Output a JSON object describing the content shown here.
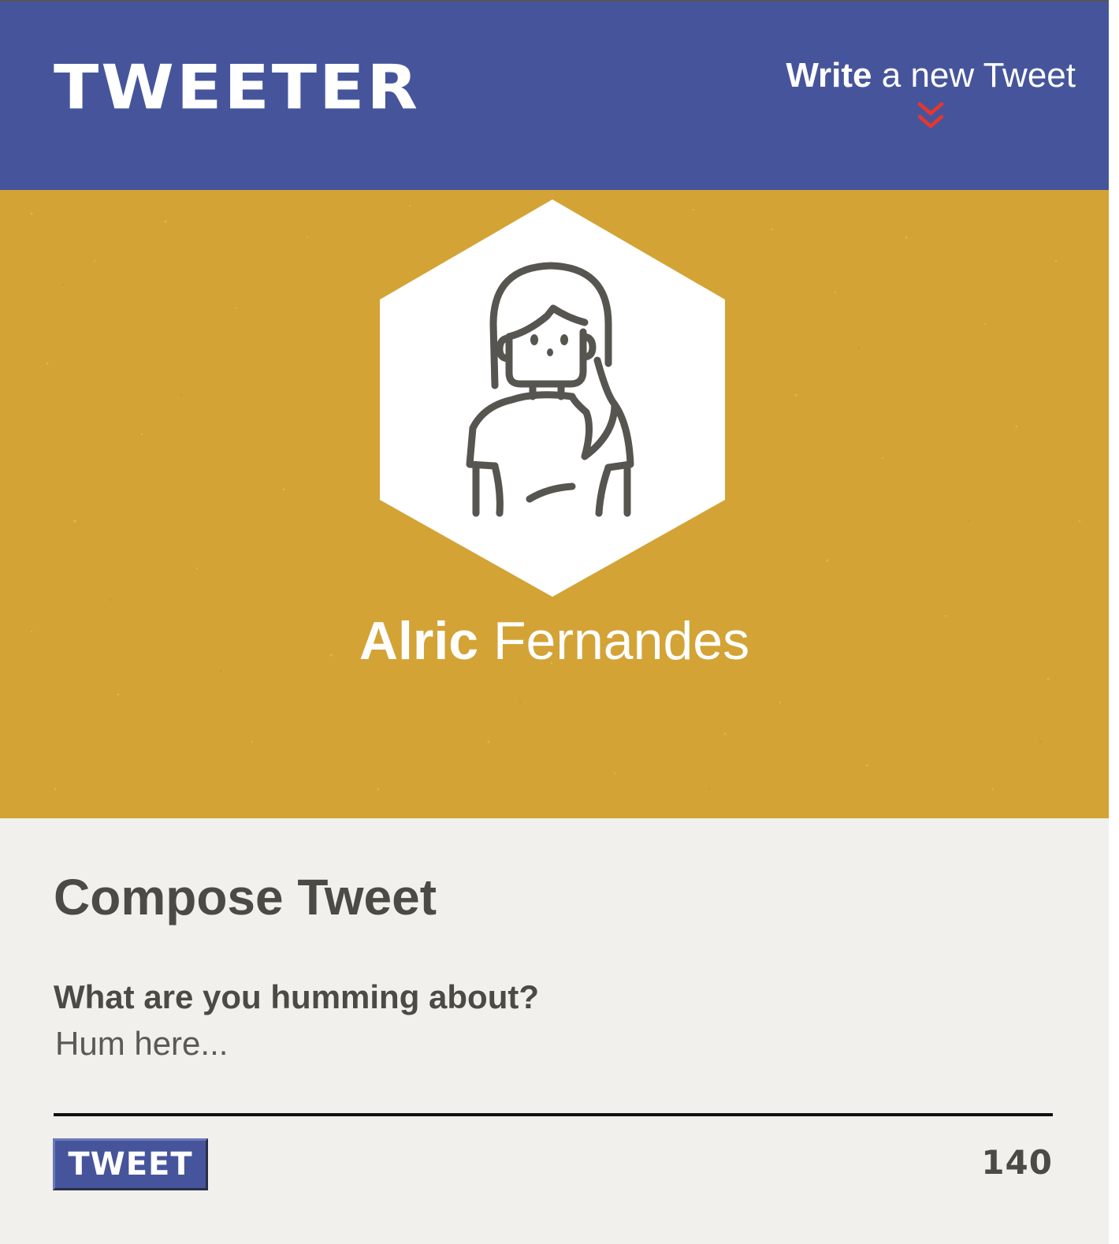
{
  "header": {
    "logo": "TWEETER",
    "write_link": {
      "bold": "Write",
      "rest": " a new Tweet"
    },
    "accent_color": "#e8362b",
    "background": "#46559b"
  },
  "profile": {
    "first_name": "Alric",
    "last_name": " Fernandes",
    "background": "#d3a336",
    "avatar_icon": "female-user-icon"
  },
  "compose": {
    "title": "Compose Tweet",
    "label": "What are you humming about?",
    "placeholder": "Hum here...",
    "button_label": "TWEET",
    "char_count": "140"
  }
}
